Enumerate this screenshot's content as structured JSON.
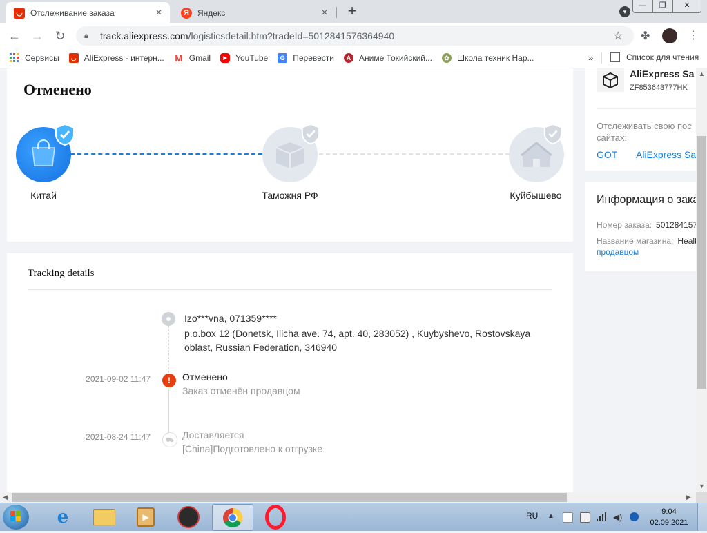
{
  "browser": {
    "tabs": [
      {
        "title": "Отслеживание заказа",
        "active": true
      },
      {
        "title": "Яндекс",
        "active": false
      }
    ],
    "url_host": "track.aliexpress.com",
    "url_path": "/logisticsdetail.htm?tradeId=5012841576364940",
    "window_controls": [
      "—",
      "❐",
      "✕"
    ],
    "bookmarks": [
      {
        "label": "Сервисы",
        "icon": "apps-grid-icon"
      },
      {
        "label": "AliExpress - интерн...",
        "icon": "aliexpress-icon"
      },
      {
        "label": "Gmail",
        "icon": "gmail-icon"
      },
      {
        "label": "YouTube",
        "icon": "youtube-icon"
      },
      {
        "label": "Перевести",
        "icon": "translate-icon"
      },
      {
        "label": "Аниме Токийский...",
        "icon": "anime-icon"
      },
      {
        "label": "Школа техник Нар...",
        "icon": "school-icon"
      }
    ],
    "bookmarks_more": "»",
    "reading_list": "Список для чтения"
  },
  "order": {
    "status_title": "Отменено",
    "stages": [
      {
        "label": "Китай",
        "state": "done"
      },
      {
        "label": "Таможня РФ",
        "state": "pending"
      },
      {
        "label": "Куйбышево",
        "state": "pending"
      }
    ]
  },
  "tracking": {
    "title": "Tracking details",
    "recipient": "Izo***vna,  071359****",
    "address": "p.o.box 12 (Donetsk, Ilicha ave. 74, apt. 40, 283052) ,  Kuybyshevo,  Rostovskaya oblast,  Russian Federation,  346940",
    "events": [
      {
        "date": "2021-09-02 11:47",
        "status": "Отменено",
        "desc": "Заказ отменён продавцом",
        "icon": "alert-icon"
      },
      {
        "date": "2021-08-24 11:47",
        "status": "Доставляется",
        "desc": "[China]Подготовлено к отгрузке",
        "icon": "truck-icon"
      }
    ]
  },
  "carrier": {
    "name": "AliExpress Sa",
    "tracking_no": "ZF853643777HK",
    "other_sites_text": "Отслеживать свою пос сайтах:",
    "links": [
      "GOT",
      "AliExpress Sav"
    ]
  },
  "order_info": {
    "title": "Информация о зака",
    "number_label": "Номер заказа:",
    "number_value": "501284157",
    "store_label": "Название магазина:",
    "store_value": "Healt",
    "store_link": "продавцом"
  },
  "taskbar": {
    "lang": "RU",
    "time": "9:04",
    "date": "02.09.2021"
  },
  "colors": {
    "accent_blue": "#1a7ed6",
    "alert_red": "#e64011",
    "aliexpress_red": "#e62e04"
  }
}
